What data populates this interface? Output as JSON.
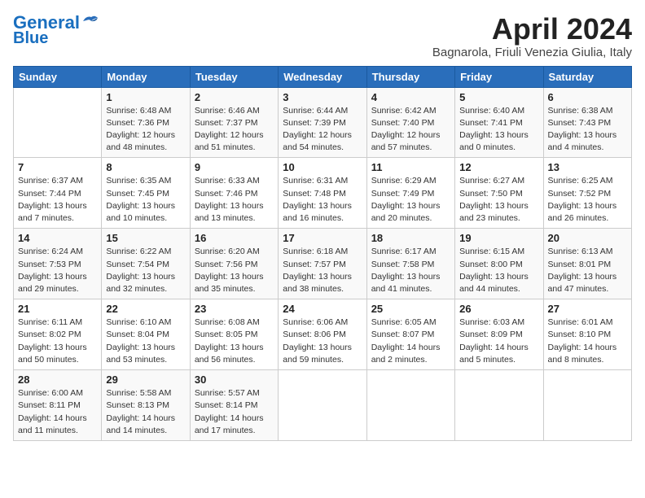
{
  "header": {
    "logo_line1": "General",
    "logo_line2": "Blue",
    "month_title": "April 2024",
    "location": "Bagnarola, Friuli Venezia Giulia, Italy"
  },
  "weekdays": [
    "Sunday",
    "Monday",
    "Tuesday",
    "Wednesday",
    "Thursday",
    "Friday",
    "Saturday"
  ],
  "weeks": [
    [
      {
        "day": "",
        "info": ""
      },
      {
        "day": "1",
        "info": "Sunrise: 6:48 AM\nSunset: 7:36 PM\nDaylight: 12 hours\nand 48 minutes."
      },
      {
        "day": "2",
        "info": "Sunrise: 6:46 AM\nSunset: 7:37 PM\nDaylight: 12 hours\nand 51 minutes."
      },
      {
        "day": "3",
        "info": "Sunrise: 6:44 AM\nSunset: 7:39 PM\nDaylight: 12 hours\nand 54 minutes."
      },
      {
        "day": "4",
        "info": "Sunrise: 6:42 AM\nSunset: 7:40 PM\nDaylight: 12 hours\nand 57 minutes."
      },
      {
        "day": "5",
        "info": "Sunrise: 6:40 AM\nSunset: 7:41 PM\nDaylight: 13 hours\nand 0 minutes."
      },
      {
        "day": "6",
        "info": "Sunrise: 6:38 AM\nSunset: 7:43 PM\nDaylight: 13 hours\nand 4 minutes."
      }
    ],
    [
      {
        "day": "7",
        "info": "Sunrise: 6:37 AM\nSunset: 7:44 PM\nDaylight: 13 hours\nand 7 minutes."
      },
      {
        "day": "8",
        "info": "Sunrise: 6:35 AM\nSunset: 7:45 PM\nDaylight: 13 hours\nand 10 minutes."
      },
      {
        "day": "9",
        "info": "Sunrise: 6:33 AM\nSunset: 7:46 PM\nDaylight: 13 hours\nand 13 minutes."
      },
      {
        "day": "10",
        "info": "Sunrise: 6:31 AM\nSunset: 7:48 PM\nDaylight: 13 hours\nand 16 minutes."
      },
      {
        "day": "11",
        "info": "Sunrise: 6:29 AM\nSunset: 7:49 PM\nDaylight: 13 hours\nand 20 minutes."
      },
      {
        "day": "12",
        "info": "Sunrise: 6:27 AM\nSunset: 7:50 PM\nDaylight: 13 hours\nand 23 minutes."
      },
      {
        "day": "13",
        "info": "Sunrise: 6:25 AM\nSunset: 7:52 PM\nDaylight: 13 hours\nand 26 minutes."
      }
    ],
    [
      {
        "day": "14",
        "info": "Sunrise: 6:24 AM\nSunset: 7:53 PM\nDaylight: 13 hours\nand 29 minutes."
      },
      {
        "day": "15",
        "info": "Sunrise: 6:22 AM\nSunset: 7:54 PM\nDaylight: 13 hours\nand 32 minutes."
      },
      {
        "day": "16",
        "info": "Sunrise: 6:20 AM\nSunset: 7:56 PM\nDaylight: 13 hours\nand 35 minutes."
      },
      {
        "day": "17",
        "info": "Sunrise: 6:18 AM\nSunset: 7:57 PM\nDaylight: 13 hours\nand 38 minutes."
      },
      {
        "day": "18",
        "info": "Sunrise: 6:17 AM\nSunset: 7:58 PM\nDaylight: 13 hours\nand 41 minutes."
      },
      {
        "day": "19",
        "info": "Sunrise: 6:15 AM\nSunset: 8:00 PM\nDaylight: 13 hours\nand 44 minutes."
      },
      {
        "day": "20",
        "info": "Sunrise: 6:13 AM\nSunset: 8:01 PM\nDaylight: 13 hours\nand 47 minutes."
      }
    ],
    [
      {
        "day": "21",
        "info": "Sunrise: 6:11 AM\nSunset: 8:02 PM\nDaylight: 13 hours\nand 50 minutes."
      },
      {
        "day": "22",
        "info": "Sunrise: 6:10 AM\nSunset: 8:04 PM\nDaylight: 13 hours\nand 53 minutes."
      },
      {
        "day": "23",
        "info": "Sunrise: 6:08 AM\nSunset: 8:05 PM\nDaylight: 13 hours\nand 56 minutes."
      },
      {
        "day": "24",
        "info": "Sunrise: 6:06 AM\nSunset: 8:06 PM\nDaylight: 13 hours\nand 59 minutes."
      },
      {
        "day": "25",
        "info": "Sunrise: 6:05 AM\nSunset: 8:07 PM\nDaylight: 14 hours\nand 2 minutes."
      },
      {
        "day": "26",
        "info": "Sunrise: 6:03 AM\nSunset: 8:09 PM\nDaylight: 14 hours\nand 5 minutes."
      },
      {
        "day": "27",
        "info": "Sunrise: 6:01 AM\nSunset: 8:10 PM\nDaylight: 14 hours\nand 8 minutes."
      }
    ],
    [
      {
        "day": "28",
        "info": "Sunrise: 6:00 AM\nSunset: 8:11 PM\nDaylight: 14 hours\nand 11 minutes."
      },
      {
        "day": "29",
        "info": "Sunrise: 5:58 AM\nSunset: 8:13 PM\nDaylight: 14 hours\nand 14 minutes."
      },
      {
        "day": "30",
        "info": "Sunrise: 5:57 AM\nSunset: 8:14 PM\nDaylight: 14 hours\nand 17 minutes."
      },
      {
        "day": "",
        "info": ""
      },
      {
        "day": "",
        "info": ""
      },
      {
        "day": "",
        "info": ""
      },
      {
        "day": "",
        "info": ""
      }
    ]
  ]
}
